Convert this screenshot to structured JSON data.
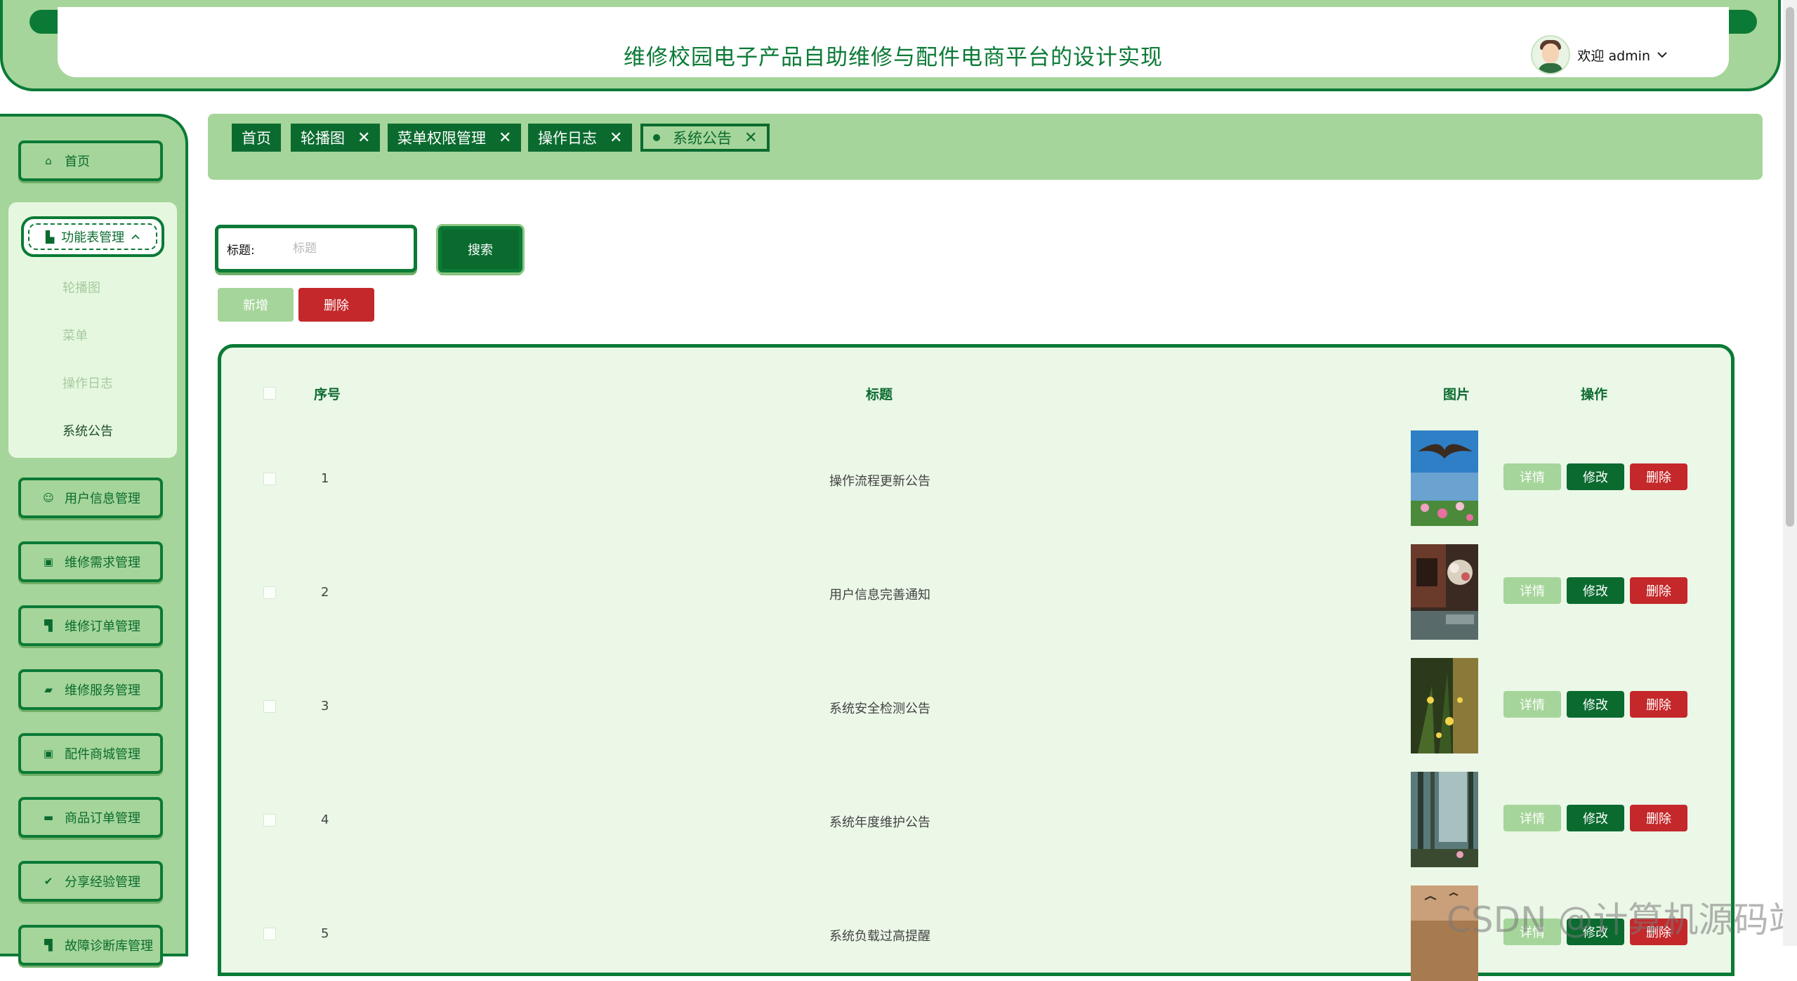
{
  "header": {
    "title": "维修校园电子产品自助维修与配件电商平台的设计实现",
    "welcome": "欢迎 admin",
    "dropdown_icon": "chevron-down-icon"
  },
  "sidebar": {
    "home": "首页",
    "group": "功能表管理",
    "sub_items": [
      "轮播图",
      "菜单",
      "操作日志",
      "系统公告"
    ],
    "items": [
      "用户信息管理",
      "维修需求管理",
      "维修订单管理",
      "维修服务管理",
      "配件商城管理",
      "商品订单管理",
      "分享经验管理",
      "故障诊断库管理"
    ]
  },
  "tabs": [
    "首页",
    "轮播图",
    "菜单权限管理",
    "操作日志",
    "系统公告"
  ],
  "search": {
    "label": "标题:",
    "placeholder": "标题",
    "button": "搜索"
  },
  "actions": {
    "add": "新增",
    "delete": "删除"
  },
  "table": {
    "headers": {
      "index": "序号",
      "title": "标题",
      "image": "图片",
      "ops": "操作"
    },
    "row_buttons": {
      "detail": "详情",
      "edit": "修改",
      "delete": "删除"
    },
    "rows": [
      {
        "index": "1",
        "title": "操作流程更新公告"
      },
      {
        "index": "2",
        "title": "用户信息完善通知"
      },
      {
        "index": "3",
        "title": "系统安全检测公告"
      },
      {
        "index": "4",
        "title": "系统年度维护公告"
      },
      {
        "index": "5",
        "title": "系统负载过高提醒"
      }
    ]
  },
  "watermark": "CSDN @计算机源码站",
  "colors": {
    "primary": "#0b6b2f",
    "light": "#a5d59a",
    "danger": "#c4282a",
    "panel": "#ebf7e7"
  }
}
